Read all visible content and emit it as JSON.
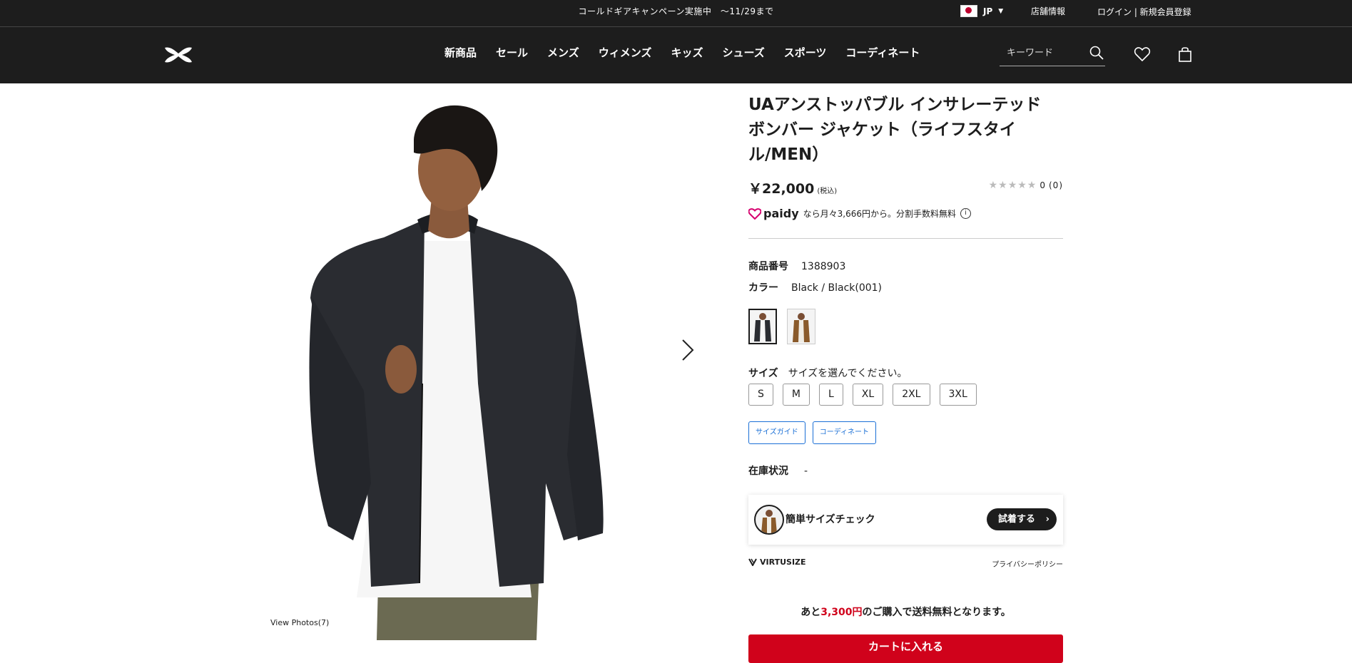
{
  "topbar": {
    "promo": "コールドギアキャンペーン実施中　〜11/29まで",
    "country": "JP",
    "store_info": "店舗情報",
    "login": "ログイン | 新規会員登録"
  },
  "nav": {
    "items": [
      "新商品",
      "セール",
      "メンズ",
      "ウィメンズ",
      "キッズ",
      "シューズ",
      "スポーツ",
      "コーディネート"
    ],
    "search_placeholder": "キーワード"
  },
  "gallery": {
    "view_photos": "View Photos(7)"
  },
  "product": {
    "title": "UAアンストッパブル インサレーテッド ボンバー ジャケット（ライフスタイル/MEN）",
    "price": "￥22,000",
    "tax": "(税込)",
    "rating_stars": "★★★★★",
    "rating_value": "0",
    "review_count": "(0)",
    "paidy_brand": "paidy",
    "paidy_text": "なら月々3,666円から。分割手数料無料",
    "product_no_label": "商品番号",
    "product_no": "1388903",
    "color_label": "カラー",
    "color_value": "Black / Black(001)",
    "size_label": "サイズ",
    "size_prompt": "サイズを選んでください。",
    "sizes": [
      "S",
      "M",
      "L",
      "XL",
      "2XL",
      "3XL"
    ],
    "size_guide": "サイズガイド",
    "coordinate": "コーディネート",
    "stock_label": "在庫状況",
    "stock_value": "-"
  },
  "virtusize": {
    "text": "簡単サイズチェック",
    "button": "試着する",
    "brand": "VIRTUSIZE",
    "privacy": "プライバシーポリシー"
  },
  "shipping": {
    "prefix": "あと",
    "amount": "3,300円",
    "suffix": "のご購入で送料無料となります。"
  },
  "cart": {
    "label": "カートに入れる"
  },
  "colors": {
    "accent_red": "#d0021b",
    "link_blue": "#1a6fd6",
    "header_bg": "#1d1d1d"
  }
}
